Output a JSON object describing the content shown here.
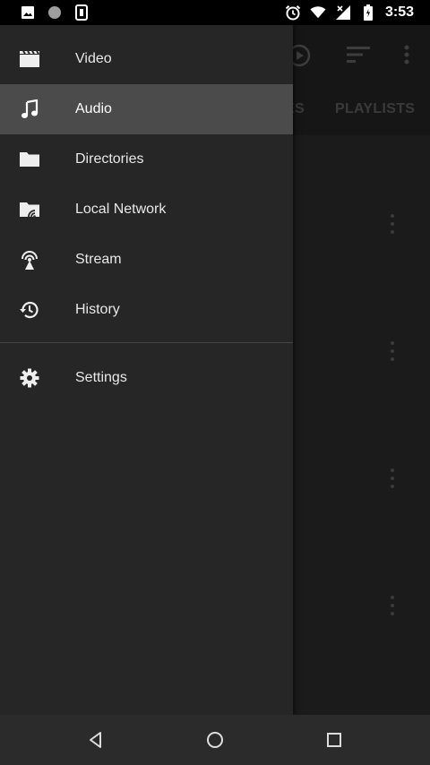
{
  "status_bar": {
    "time": "3:53",
    "left_icons": [
      "image-icon",
      "circle-icon",
      "sim-icon"
    ],
    "right_icons": [
      "alarm-icon",
      "wifi-icon",
      "signal-icon",
      "battery-icon"
    ]
  },
  "background_app": {
    "tabs": [
      {
        "label": "ES"
      },
      {
        "label": "PLAYLISTS"
      }
    ],
    "toolbar_icons": [
      "play-history-icon",
      "sort-icon",
      "overflow-menu-icon"
    ]
  },
  "drawer": {
    "items": [
      {
        "label": "Video",
        "icon": "video-icon",
        "active": false
      },
      {
        "label": "Audio",
        "icon": "music-note-icon",
        "active": true
      },
      {
        "label": "Directories",
        "icon": "folder-icon",
        "active": false
      },
      {
        "label": "Local Network",
        "icon": "network-folder-icon",
        "active": false
      },
      {
        "label": "Stream",
        "icon": "stream-icon",
        "active": false
      },
      {
        "label": "History",
        "icon": "history-icon",
        "active": false
      }
    ],
    "settings": {
      "label": "Settings",
      "icon": "gear-icon"
    }
  },
  "colors": {
    "drawer_bg": "#262626",
    "active_item_bg": "#4b4b4b",
    "text": "#e8e8e8",
    "status_bar_bg": "#000000",
    "nav_bar_bg": "#2b2b2b"
  },
  "navigation_bar": {
    "buttons": [
      "back-icon",
      "home-icon",
      "recents-icon"
    ]
  }
}
